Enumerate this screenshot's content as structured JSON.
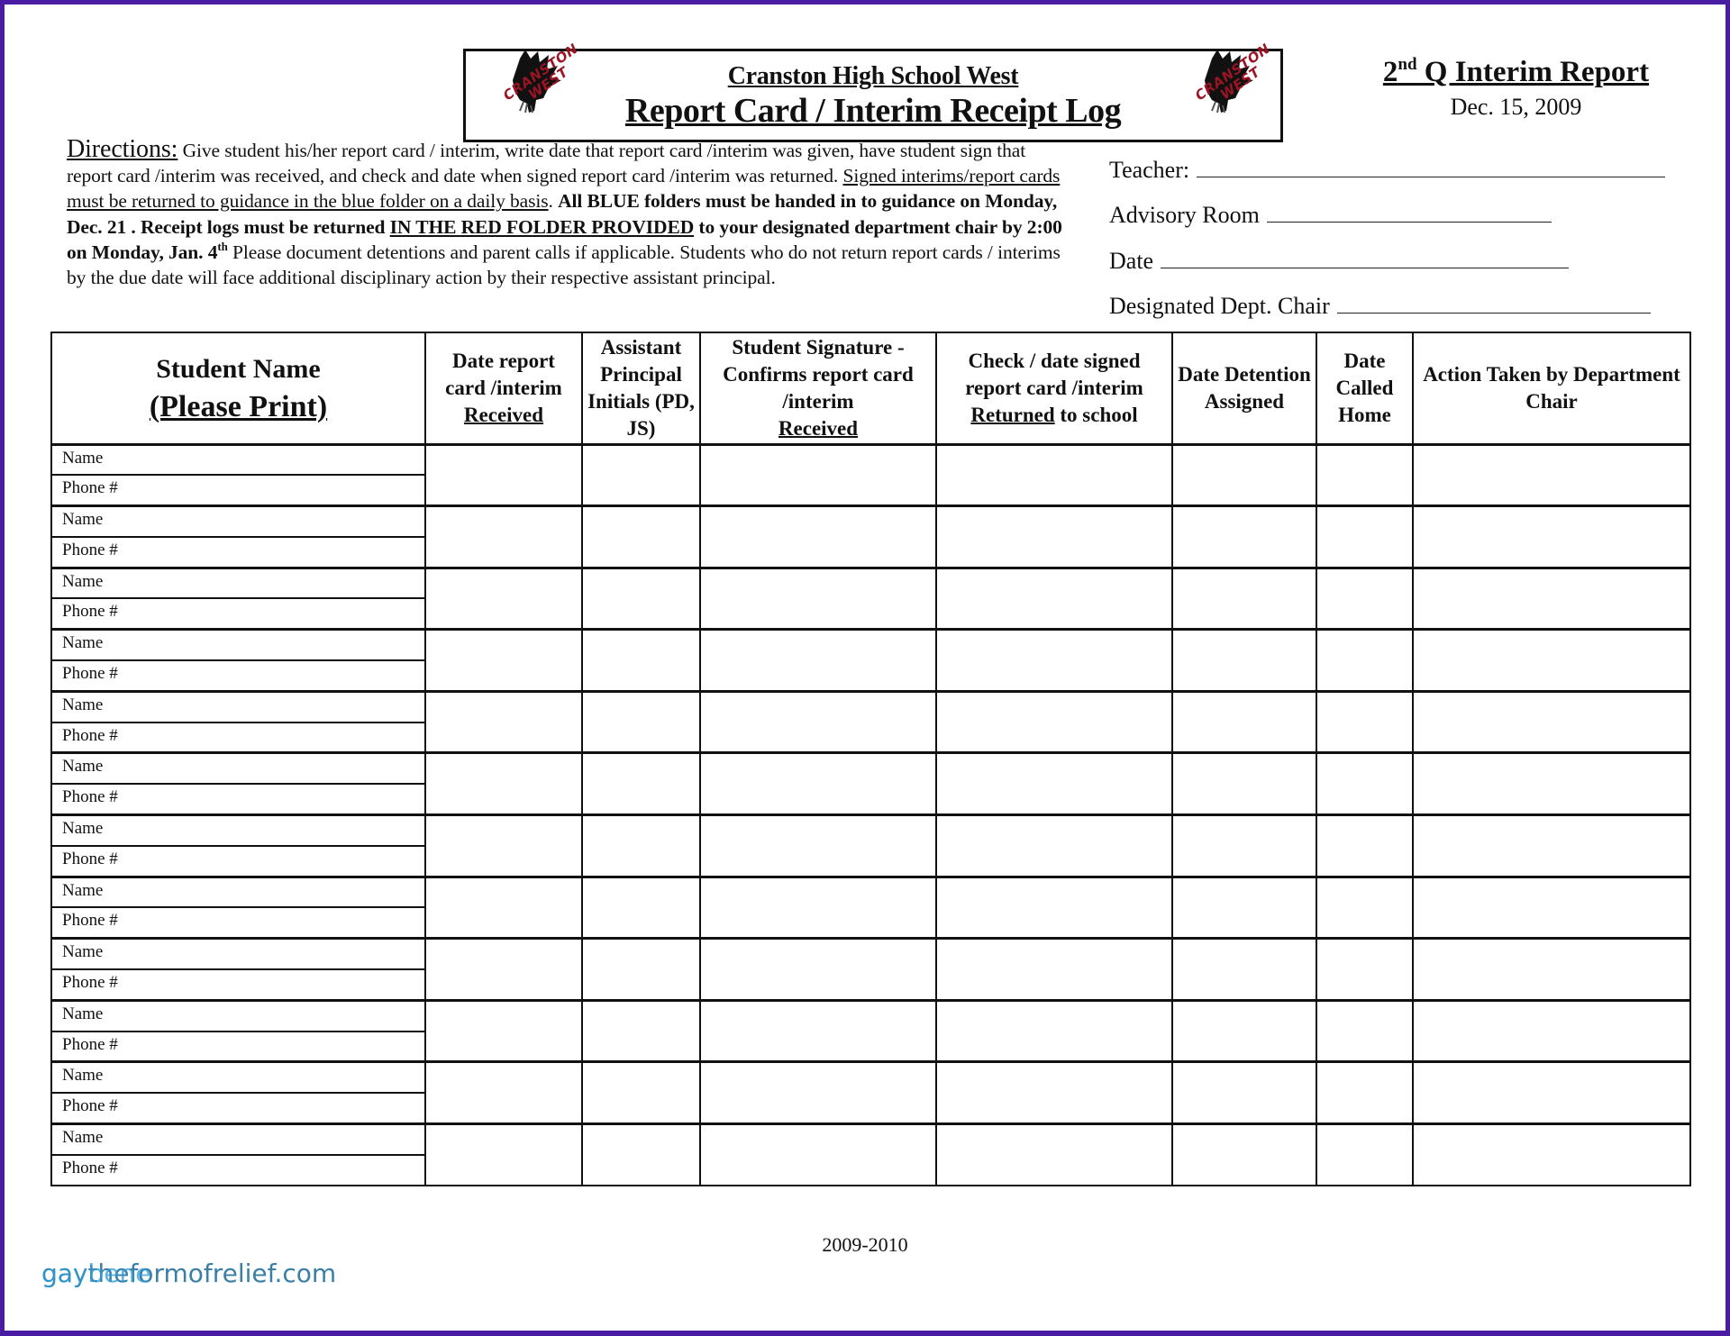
{
  "header": {
    "school_name": "Cranston High School West",
    "log_title": "Report Card / Interim Receipt Log",
    "logo_text_line1": "CRANSTON",
    "logo_text_line2": "WEST",
    "report_ordinal": "2",
    "report_ordinal_suffix": "nd",
    "report_title_rest": " Q Interim Report",
    "report_date": "Dec. 15, 2009"
  },
  "fields": [
    {
      "label": "Teacher:"
    },
    {
      "label": "Advisory Room"
    },
    {
      "label": "Date"
    },
    {
      "label": "Designated Dept. Chair"
    }
  ],
  "directions": {
    "lead": "Directions:",
    "p1": "  Give student his/her report card / interim, write date that report card /interim was given, have student sign that report card /interim was received, and check and date when signed report card /interim was returned.  ",
    "u1": "Signed interims/report cards must be returned to guidance in the blue folder on a daily basis",
    "p2": ". ",
    "b1": "All BLUE folders must be handed in to guidance on Monday, Dec. 21 .  Receipt logs must be returned ",
    "bu1": "IN THE RED FOLDER PROVIDED",
    "b2": " to your designated department chair  by 2:00 on Monday, Jan. 4",
    "b2_sup": "th",
    "p3": "  Please document detentions and parent calls if applicable.  Students who do not return report cards / interims by the due date will face additional disciplinary action by their respective assistant principal."
  },
  "table": {
    "headers": {
      "student_name": "Student Name",
      "please_print": "(Please Print)",
      "date_received_pre": "Date report card /interim",
      "date_received_u": "Received",
      "ap_initials": "Assistant Principal Initials (PD, JS)",
      "signature_pre": "Student Signature - Confirms report card /interim",
      "signature_u": "Received",
      "check_pre": "Check / date signed report card /interim",
      "check_u": "Returned",
      "check_post": " to school",
      "detention": "Date Detention Assigned",
      "called_home": "Date Called Home",
      "action": "Action Taken by Department Chair"
    },
    "row_labels": {
      "name": "Name",
      "phone": "Phone #"
    },
    "row_count": 12
  },
  "footer": {
    "year": "2009-2010",
    "watermark_a": "gaytheformofrelief.com",
    "watermark_b": "gaybene"
  },
  "colors": {
    "frame": "#4a1ba3",
    "logo_red": "#9b1423",
    "watermark": "#3a7fa8"
  }
}
